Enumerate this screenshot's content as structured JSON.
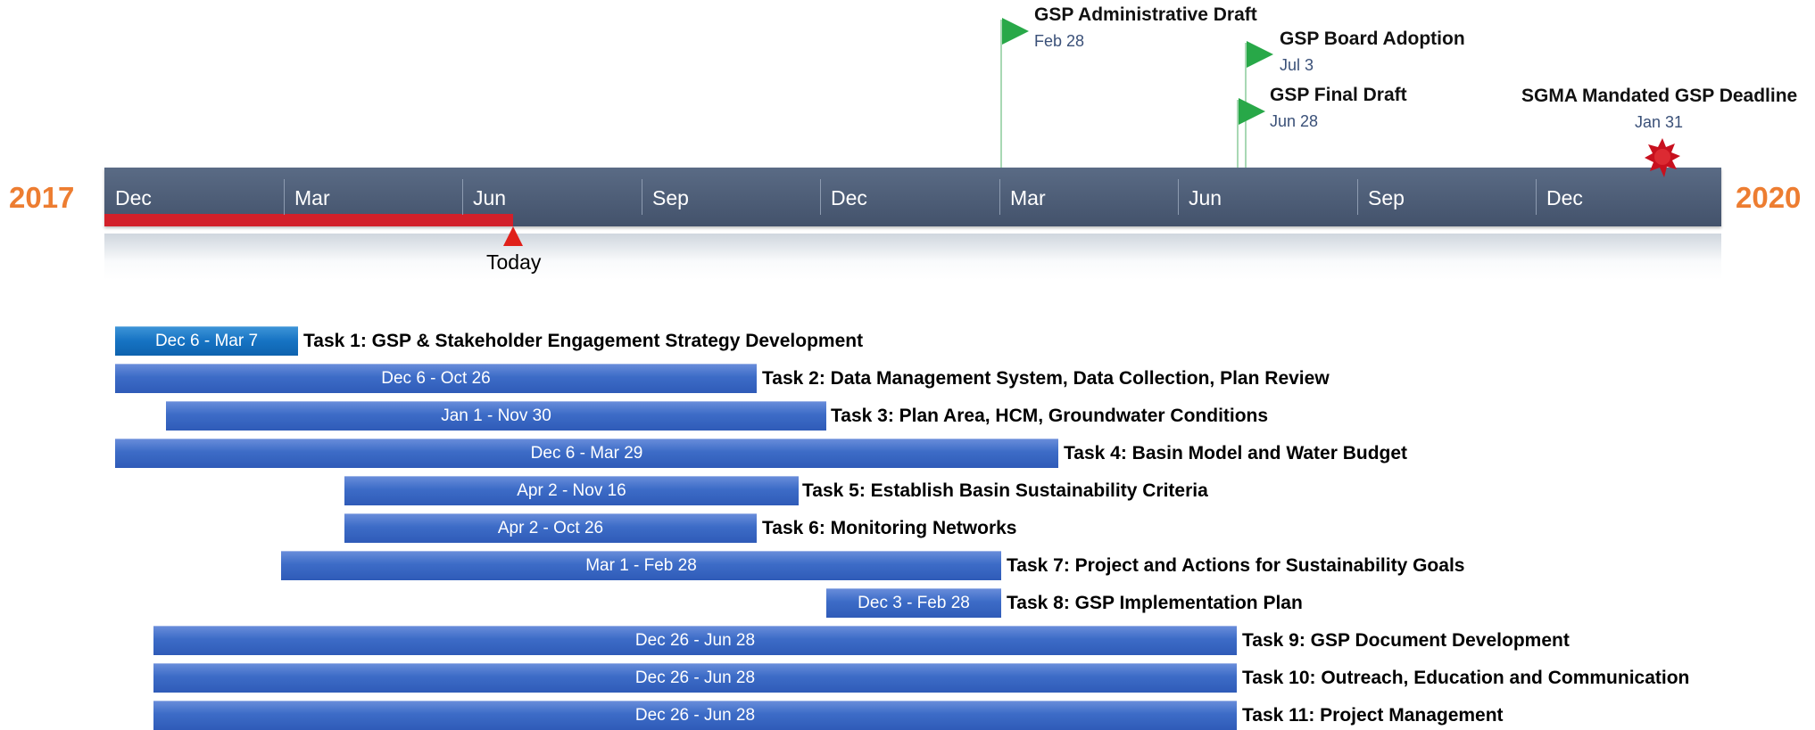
{
  "timeline": {
    "start_year": "2017",
    "end_year": "2020",
    "months": [
      "Dec",
      "Mar",
      "Jun",
      "Sep",
      "Dec",
      "Mar",
      "Jun",
      "Sep",
      "Dec"
    ],
    "today_label": "Today"
  },
  "milestones": [
    {
      "title": "GSP Administrative Draft",
      "date": "Feb 28",
      "icon": "flag-icon"
    },
    {
      "title": "GSP Board Adoption",
      "date": "Jul 3",
      "icon": "flag-icon"
    },
    {
      "title": "GSP Final Draft",
      "date": "Jun 28",
      "icon": "flag-icon"
    },
    {
      "title": "SGMA Mandated GSP Deadline",
      "date": "Jan 31",
      "icon": "star-burst-icon"
    }
  ],
  "tasks": [
    {
      "dates": "Dec 6 - Mar 7",
      "name": "Task 1: GSP & Stakeholder Engagement Strategy Development"
    },
    {
      "dates": "Dec 6 - Oct 26",
      "name": "Task 2: Data Management System, Data Collection, Plan Review"
    },
    {
      "dates": "Jan 1 - Nov 30",
      "name": "Task 3: Plan Area, HCM, Groundwater Conditions"
    },
    {
      "dates": "Dec 6 - Mar 29",
      "name": "Task 4: Basin Model and Water Budget"
    },
    {
      "dates": "Apr 2 - Nov 16",
      "name": "Task 5: Establish Basin Sustainability Criteria"
    },
    {
      "dates": "Apr 2 - Oct 26",
      "name": "Task 6: Monitoring Networks"
    },
    {
      "dates": "Mar 1 - Feb 28",
      "name": "Task 7: Project and Actions for Sustainability Goals"
    },
    {
      "dates": "Dec 3 - Feb 28",
      "name": "Task 8: GSP Implementation Plan"
    },
    {
      "dates": "Dec 26 - Jun 28",
      "name": "Task 9: GSP Document Development"
    },
    {
      "dates": "Dec 26 - Jun 28",
      "name": "Task 10: Outreach, Education and Communication"
    },
    {
      "dates": "Dec 26 - Jun 28",
      "name": "Task 11: Project Management"
    }
  ],
  "colors": {
    "axis": "#4b5a72",
    "progress": "#d2202a",
    "year": "#ed7d31",
    "bar": "#3d6cc7",
    "bar_first": "#1673c3",
    "flag": "#28a848",
    "deadline": "#c8101e"
  }
}
